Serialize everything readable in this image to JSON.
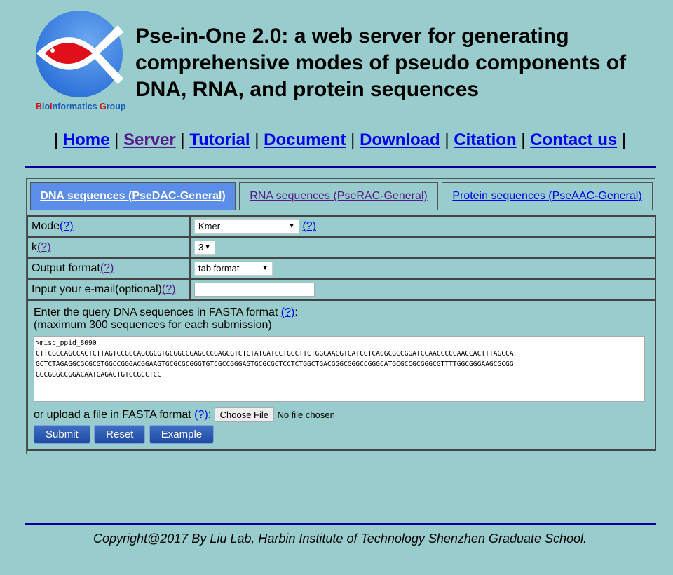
{
  "header": {
    "logo_text": "BioInformatics Group",
    "title": "Pse-in-One 2.0: a web server for generating comprehensive modes of pseudo components of DNA, RNA, and protein sequences"
  },
  "nav": [
    "Home",
    "Server",
    "Tutorial",
    "Document",
    "Download",
    "Citation",
    "Contact us"
  ],
  "tabs": [
    "DNA sequences (PseDAC-General)",
    "RNA sequences (PseRAC-General)",
    "Protein sequences (PseAAC-General)"
  ],
  "colors": {
    "background": "#99cccc",
    "active_tab": "#5a8ee8",
    "rule": "#000099",
    "button": "#2a56ad"
  },
  "form": {
    "help": "(?)",
    "mode_label": "Mode",
    "mode_value": "Kmer",
    "k_label": "k",
    "k_value": "3",
    "output_label": "Output format",
    "output_value": "tab format",
    "email_label": "Input your e-mail(optional)",
    "email_value": "",
    "query_label": "Enter the query DNA sequences in FASTA format ",
    "query_note": "(maximum 300 sequences for each submission)",
    "sequence": ">misc_ppid_8090\nCTTCGCCAGCCACTCTTAGTCCGCCAGCGCGTGCGGCGGAGGCCGAGCGTCTCTATGATCCTGGCTTCTGGCAACGTCATCGTCACGCGCCGGATCCAACCCCCAACCACTTTAGCCA\nGCTCTAGAGGCGCGCGTGGCCGGGACGGAAGTGCGCGCGGGTGTCGCCGGGAGTGCGCGCTCCTCTGGCTGACGGGCGGGCCGGGCATGCGCCGCGGGCGTTTTGGCGGGAAGCGCGG\nGGCGGGCCGGACAATGAGAGTGTCCGCCTCC",
    "upload_label": "or upload a file in FASTA format ",
    "choose_file": "Choose File",
    "no_file": "No file chosen",
    "submit": "Submit",
    "reset": "Reset",
    "example": "Example"
  },
  "footer": "Copyright@2017 By Liu Lab, Harbin Institute of Technology Shenzhen Graduate School."
}
